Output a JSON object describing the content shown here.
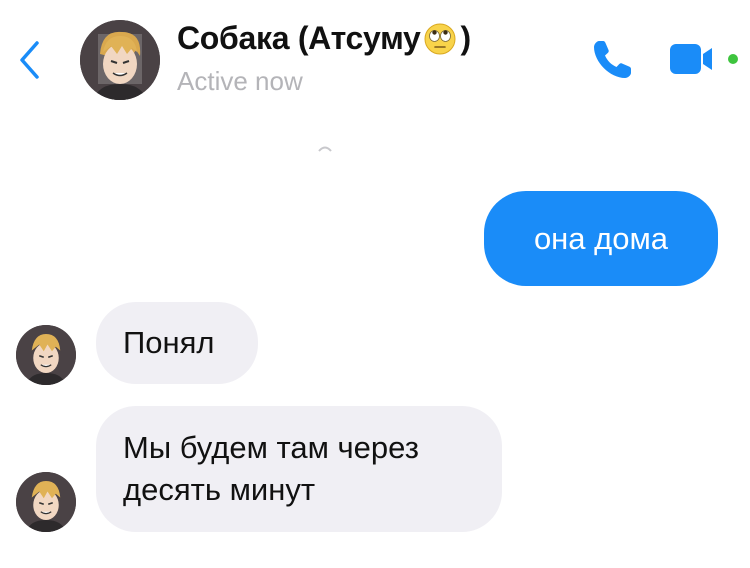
{
  "header": {
    "name_text": "Собака (Атсуму",
    "name_close": ")",
    "name_emoji": "rolling-eyes-emoji",
    "status": "Active now",
    "icons": {
      "back": "chevron-left-icon",
      "call": "phone-icon",
      "video": "video-camera-icon"
    },
    "accent_color": "#1a8cf8",
    "online_dot_color": "#3ec43e"
  },
  "messages": [
    {
      "direction": "outgoing",
      "text": "она дома"
    },
    {
      "direction": "incoming",
      "text": "Понял"
    },
    {
      "direction": "incoming",
      "text": "Мы будем там через\nдесять минут"
    }
  ],
  "colors": {
    "outgoing_bubble": "#1a8cf8",
    "incoming_bubble": "#f0eff4",
    "status_text": "#b4b4b8"
  }
}
